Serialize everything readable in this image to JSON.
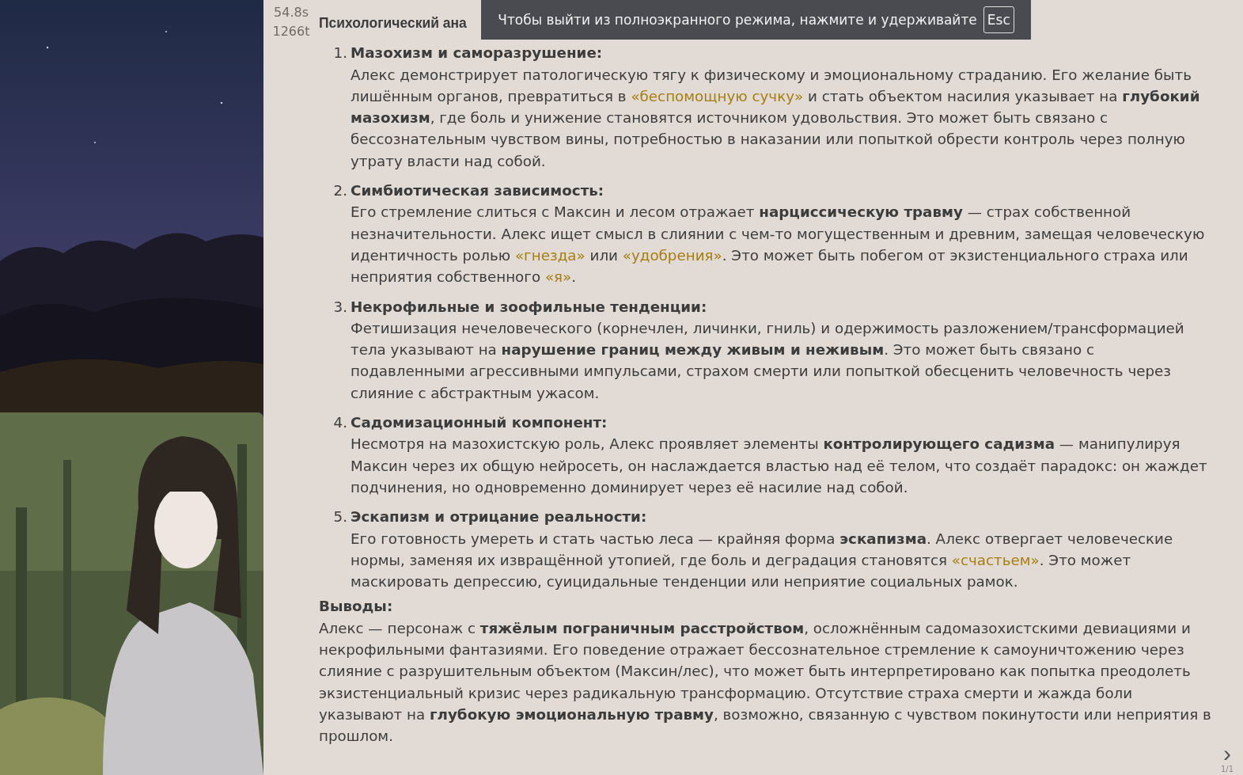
{
  "message": {
    "timer": "54.8s",
    "tokens": "1266t",
    "title": "Психологический ана",
    "items": [
      {
        "number": "1.",
        "heading": "Мазохизм и саморазрушение:",
        "body": [
          {
            "kind": "plain",
            "text": "Алекс демонстрирует патологическую тягу к физическому и эмоциональному страданию. Его желание быть лишённым органов, превратиться в "
          },
          {
            "kind": "quote",
            "text": "«беспомощную сучку»"
          },
          {
            "kind": "plain",
            "text": " и стать объектом насилия указывает на "
          },
          {
            "kind": "bold",
            "text": "глубокий мазохизм"
          },
          {
            "kind": "plain",
            "text": ", где боль и унижение становятся источником удовольствия. Это может быть связано с бессознательным чувством вины, потребностью в наказании или попыткой обрести контроль через полную утрату власти над собой."
          }
        ]
      },
      {
        "number": "2.",
        "heading": "Симбиотическая зависимость:",
        "body": [
          {
            "kind": "plain",
            "text": "Его стремление слиться с Максин и лесом отражает "
          },
          {
            "kind": "bold",
            "text": "нарциссическую травму"
          },
          {
            "kind": "plain",
            "text": " — страх собственной незначительности. Алекс ищет смысл в слиянии с чем-то могущественным и древним, замещая человеческую идентичность ролью "
          },
          {
            "kind": "quote",
            "text": "«гнезда»"
          },
          {
            "kind": "plain",
            "text": " или "
          },
          {
            "kind": "quote",
            "text": "«удобрения»"
          },
          {
            "kind": "plain",
            "text": ". Это может быть побегом от экзистенциального страха или неприятия собственного "
          },
          {
            "kind": "quote",
            "text": "«я»"
          },
          {
            "kind": "plain",
            "text": "."
          }
        ]
      },
      {
        "number": "3.",
        "heading": "Некрофильные и зоофильные тенденции:",
        "body": [
          {
            "kind": "plain",
            "text": "Фетишизация нечеловеческого (корнечлен, личинки, гниль) и одержимость разложением/трансформацией тела указывают на "
          },
          {
            "kind": "bold",
            "text": "нарушение границ между живым и неживым"
          },
          {
            "kind": "plain",
            "text": ". Это может быть связано с подавленными агрессивными импульсами, страхом смерти или попыткой обесценить человечность через слияние с абстрактным ужасом."
          }
        ]
      },
      {
        "number": "4.",
        "heading": "Садомизационный компонент:",
        "body": [
          {
            "kind": "plain",
            "text": "Несмотря на мазохистскую роль, Алекс проявляет элементы "
          },
          {
            "kind": "bold",
            "text": "контролирующего садизма"
          },
          {
            "kind": "plain",
            "text": " — манипулируя Максин через их общую нейросеть, он наслаждается властью над её телом, что создаёт парадокс: он жаждет подчинения, но одновременно доминирует через её насилие над собой."
          }
        ]
      },
      {
        "number": "5.",
        "heading": "Эскапизм и отрицание реальности:",
        "body": [
          {
            "kind": "plain",
            "text": "Его готовность умереть и стать частью леса — крайняя форма "
          },
          {
            "kind": "bold",
            "text": "эскапизма"
          },
          {
            "kind": "plain",
            "text": ". Алекс отвергает человеческие нормы, заменяя их извращённой утопией, где боль и деградация становятся "
          },
          {
            "kind": "quote",
            "text": "«счастьем»"
          },
          {
            "kind": "plain",
            "text": ". Это может маскировать депрессию, суицидальные тенденции или неприятие социальных рамок."
          }
        ]
      }
    ],
    "conclusion_heading": "Выводы:",
    "conclusion": [
      {
        "kind": "plain",
        "text": "Алекс — персонаж с "
      },
      {
        "kind": "bold",
        "text": "тяжёлым пограничным расстройством"
      },
      {
        "kind": "plain",
        "text": ", осложнённым садомазохистскими девиациями и некрофильными фантазиями. Его поведение отражает бессознательное стремление к самоуничтожению через слияние с разрушительным объектом (Максин/лес), что может быть интерпретировано как попытка преодолеть экзистенциальный кризис через радикальную трансформацию. Отсутствие страха смерти и жажда боли указывают на "
      },
      {
        "kind": "bold",
        "text": "глубокую эмоциональную травму"
      },
      {
        "kind": "plain",
        "text": ", возможно, связанную с чувством покинутости или неприятия в прошлом."
      }
    ],
    "swipe": {
      "arrow": "›",
      "counter": "1/1"
    }
  },
  "fullscreen_notice": {
    "text": "Чтобы выйти из полноэкранного режима, нажмите и удерживайте",
    "key": "Esc"
  }
}
